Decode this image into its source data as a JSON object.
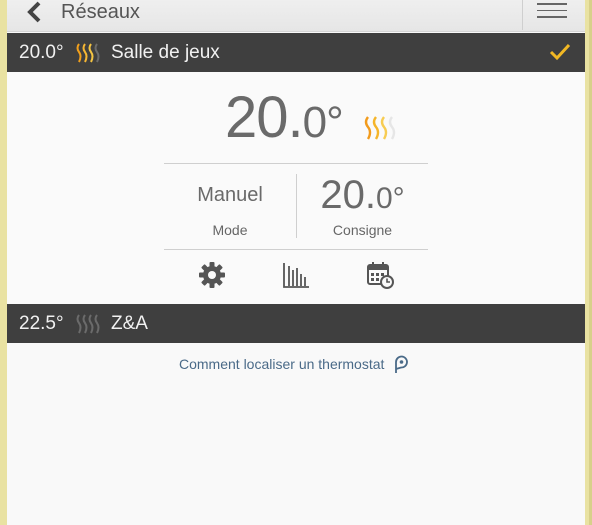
{
  "header": {
    "back_label": "Réseaux"
  },
  "zones": [
    {
      "temp": "20.0°",
      "name": "Salle de jeux",
      "heating": true,
      "selected": true
    },
    {
      "temp": "22.5°",
      "name": "Z&A",
      "heating": false,
      "selected": false
    }
  ],
  "detail": {
    "temp_int": "20.",
    "temp_dec": "0",
    "temp_deg": "°",
    "mode_value": "Manuel",
    "mode_label": "Mode",
    "setpoint_int": "20.",
    "setpoint_dec": "0",
    "setpoint_deg": "°",
    "setpoint_label": "Consigne"
  },
  "footer": {
    "locate_link": "Comment localiser un thermostat"
  },
  "colors": {
    "bar_bg": "#3f3f3f",
    "accent_check": "#f2b824",
    "heat_orange": "#f29b1c",
    "heat_yellow": "#f5c542",
    "frame": "#e9e2a2",
    "link": "#4a6a88"
  },
  "icons": [
    "chevron-left-icon",
    "hamburger-menu-icon",
    "heat-waves-icon",
    "checkmark-icon",
    "gear-icon",
    "bar-chart-icon",
    "calendar-clock-icon",
    "location-pin-icon"
  ]
}
